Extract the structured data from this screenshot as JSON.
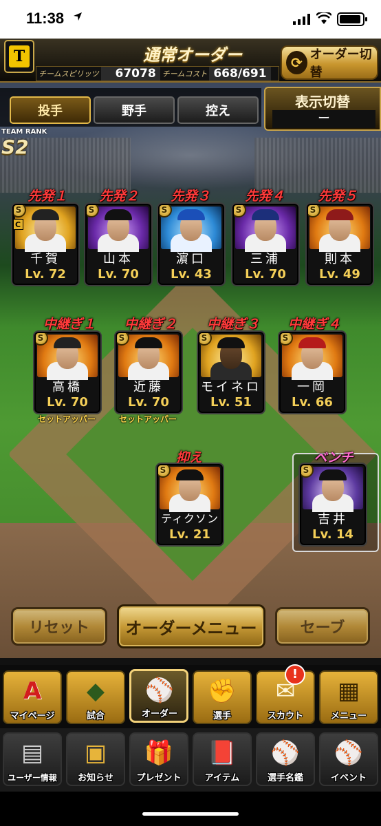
{
  "status_bar": {
    "time": "11:38"
  },
  "header": {
    "title": "通常オーダー",
    "team_logo": "タイガース",
    "order_switch_label": "オーダー切替",
    "team_spirits_label": "チームスピリッツ",
    "team_spirits_value": "67078",
    "team_cost_label": "チームコスト",
    "team_cost_value": "668/691"
  },
  "tabs": [
    {
      "label": "投手",
      "selected": true
    },
    {
      "label": "野手",
      "selected": false
    },
    {
      "label": "控え",
      "selected": false
    }
  ],
  "display_switch": {
    "label": "表示切替",
    "value": "ー"
  },
  "team_rank": {
    "label": "TEAM RANK",
    "value": "S2"
  },
  "starters": [
    {
      "slot": "先発１",
      "name": "千賀",
      "level": "Lv. 72",
      "rarity": "C"
    },
    {
      "slot": "先発２",
      "name": "山本",
      "level": "Lv. 70"
    },
    {
      "slot": "先発３",
      "name": "濵口",
      "level": "Lv. 43"
    },
    {
      "slot": "先発４",
      "name": "三浦",
      "level": "Lv. 70"
    },
    {
      "slot": "先発５",
      "name": "則本",
      "level": "Lv. 49"
    }
  ],
  "relievers": [
    {
      "slot": "中継ぎ１",
      "name": "高橋",
      "level": "Lv. 70",
      "role": "セットアッパー"
    },
    {
      "slot": "中継ぎ２",
      "name": "近藤",
      "level": "Lv. 70",
      "role": "セットアッパー"
    },
    {
      "slot": "中継ぎ３",
      "name": "モイネロ",
      "level": "Lv. 51"
    },
    {
      "slot": "中継ぎ４",
      "name": "一岡",
      "level": "Lv. 66"
    }
  ],
  "closer": {
    "slot": "抑え",
    "name": "ティクソン",
    "level": "Lv. 21"
  },
  "bench": {
    "slot": "ベンチ",
    "name": "吉井",
    "level": "Lv. 14"
  },
  "actions": {
    "reset": "リセット",
    "order_menu": "オーダーメニュー",
    "save": "セーブ"
  },
  "nav_main": [
    {
      "label": "マイページ",
      "icon": "A"
    },
    {
      "label": "試合",
      "icon": "◆"
    },
    {
      "label": "オーダー",
      "icon": "⚾"
    },
    {
      "label": "選手",
      "icon": "✊"
    },
    {
      "label": "スカウト",
      "icon": "✉"
    },
    {
      "label": "メニュー",
      "icon": "▦"
    }
  ],
  "scout_badge": "!",
  "nav_sub": [
    {
      "label": "ユーザー情報",
      "icon": "▤"
    },
    {
      "label": "お知らせ",
      "icon": "▣"
    },
    {
      "label": "プレゼント",
      "icon": "🎁"
    },
    {
      "label": "アイテム",
      "icon": "📕"
    },
    {
      "label": "選手名鑑",
      "icon": "⚾"
    },
    {
      "label": "イベント",
      "icon": "⚾"
    }
  ],
  "colors": {
    "accent_gold": "#c9962e",
    "slot_red": "#ff3a3a",
    "bench_pink": "#ff6cd0",
    "level_yellow": "#f4cf58"
  }
}
